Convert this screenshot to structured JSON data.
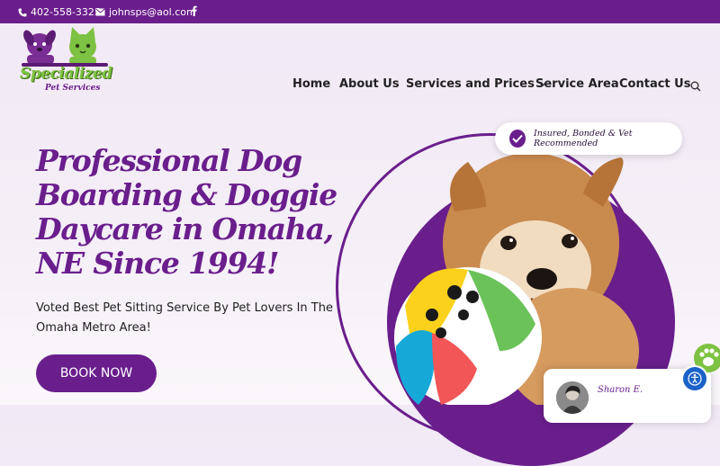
{
  "topbar": {
    "phone": "402-558-3325",
    "email": "johnsps@aol.com",
    "social_icon": "facebook-icon"
  },
  "logo": {
    "line1": "Specialized",
    "line2": "Pet Services"
  },
  "nav": {
    "items": [
      {
        "label": "Home"
      },
      {
        "label": "About Us"
      },
      {
        "label": "Services and Prices"
      },
      {
        "label": "Service Area"
      },
      {
        "label": "Contact Us"
      }
    ]
  },
  "hero": {
    "title_lines": [
      "Professional Dog",
      "Boarding & Doggie",
      "Daycare in Omaha,",
      "NE Since 1994!"
    ],
    "subtitle": "Voted Best Pet Sitting Service By Pet Lovers In The Omaha Metro Area!",
    "cta": "BOOK NOW"
  },
  "badge": {
    "text": "Insured, Bonded & Vet Recommended"
  },
  "review": {
    "name": "Sharon E."
  },
  "colors": {
    "brand_purple": "#6a1e8c",
    "logo_green": "#7dc242",
    "accessibility_blue": "#1b62c9"
  }
}
